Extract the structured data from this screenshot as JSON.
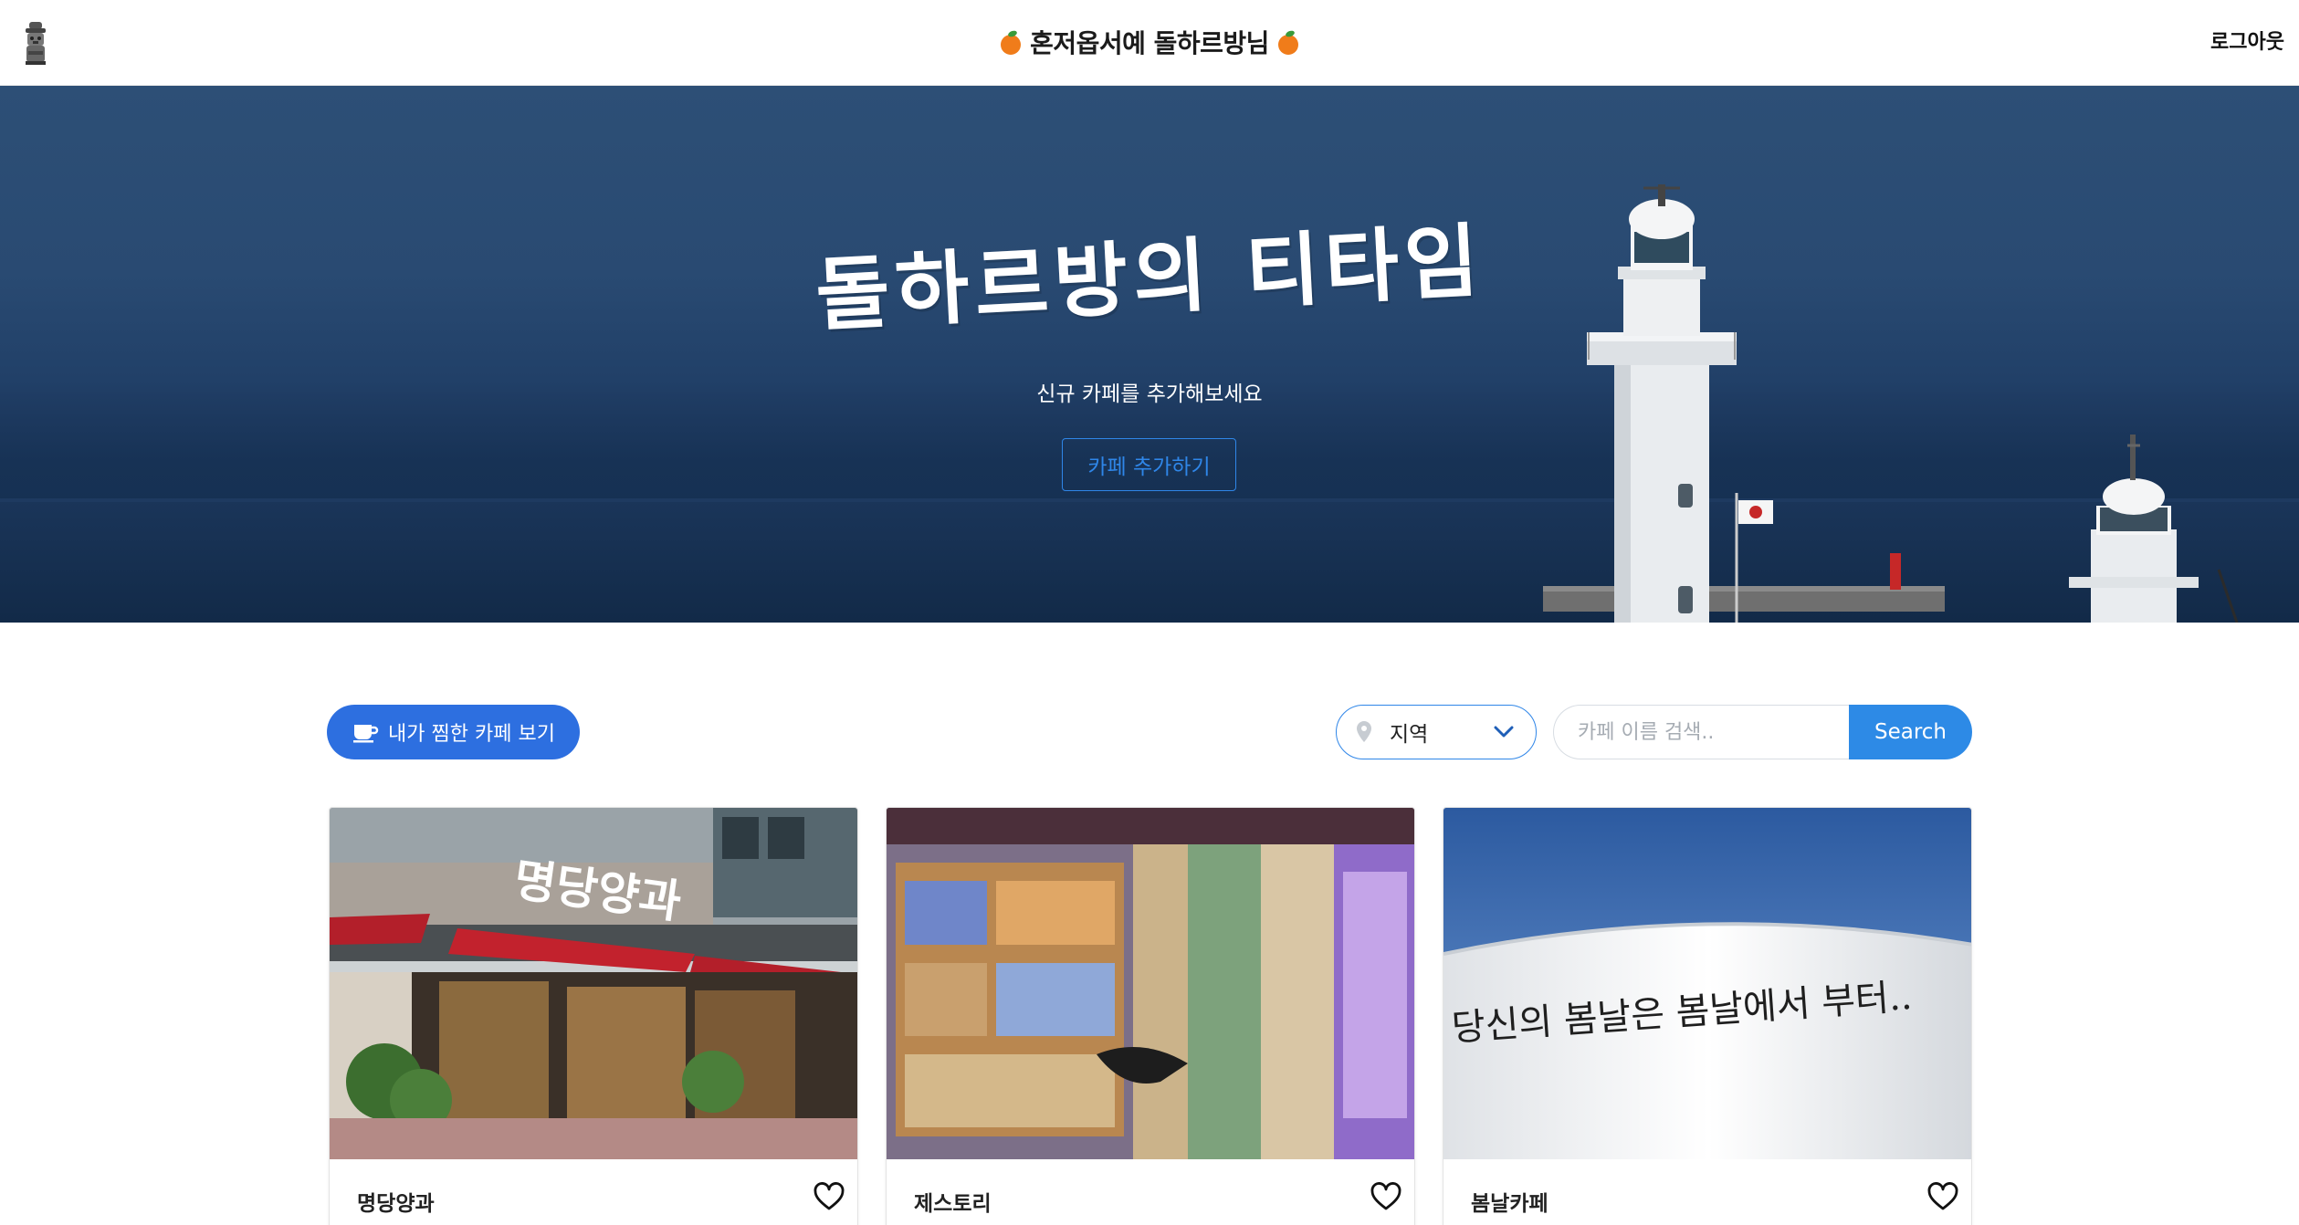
{
  "navbar": {
    "title": "혼저옵서예 돌하르방님",
    "logout": "로그아웃",
    "logo_icon": "dolhareubang-icon",
    "title_icon": "tangerine-icon"
  },
  "hero": {
    "heading": "돌하르방의 티타임",
    "subtitle": "신규 카페를 추가해보세요",
    "add_button": "카페 추가하기"
  },
  "toolbar": {
    "favorites_button": "내가 찜한 카페 보기",
    "favorites_icon": "coffee-cup-icon",
    "region_label": "지역",
    "search_placeholder": "카페 이름 검색..",
    "search_button": "Search"
  },
  "cards": [
    {
      "name": "명당양과",
      "photo": "storefront-photo",
      "sign": "명당양과"
    },
    {
      "name": "제스토리",
      "photo": "gift-shop-photo"
    },
    {
      "name": "봄날카페",
      "photo": "white-cup-photo",
      "cup_text": "당신의 봄날은 봄날에서 부터.."
    }
  ],
  "colors": {
    "primary": "#2d6fe0",
    "accent_blue": "#2f86e8",
    "search_blue": "#2d8ae6",
    "hero_sky": "#2d4f76",
    "hero_sea": "#142c4d"
  }
}
